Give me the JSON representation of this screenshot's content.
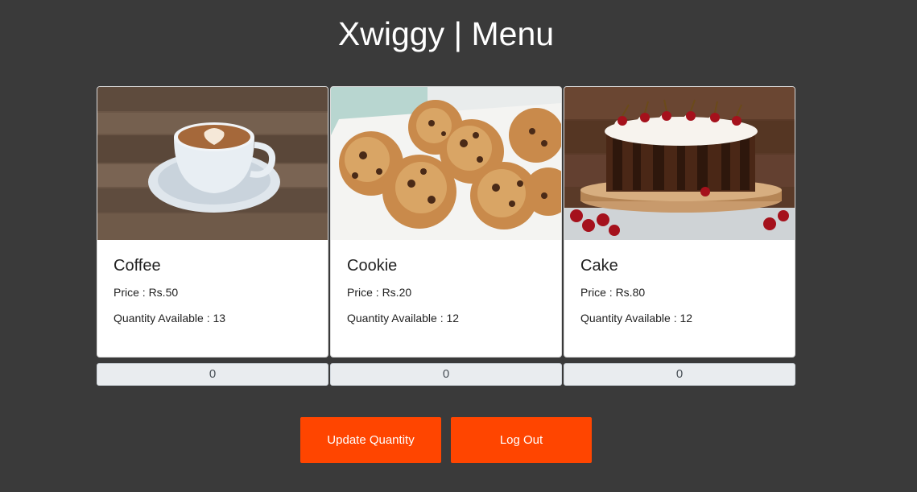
{
  "page": {
    "title": "Xwiggy | Menu"
  },
  "items": [
    {
      "name": "Coffee",
      "price": "Price : Rs.50",
      "quantity": "Quantity Available : 13",
      "order_qty": "0",
      "image_icon": "coffee-cup-photo"
    },
    {
      "name": "Cookie",
      "price": "Price : Rs.20",
      "quantity": "Quantity Available : 12",
      "order_qty": "0",
      "image_icon": "cookies-photo"
    },
    {
      "name": "Cake",
      "price": "Price : Rs.80",
      "quantity": "Quantity Available : 12",
      "order_qty": "0",
      "image_icon": "cake-photo"
    }
  ],
  "actions": {
    "update_label": "Update Quantity",
    "logout_label": "Log Out"
  },
  "colors": {
    "background": "#3a3a3a",
    "accent": "#ff4500",
    "card": "#ffffff",
    "input_bg": "#e9ecef"
  }
}
